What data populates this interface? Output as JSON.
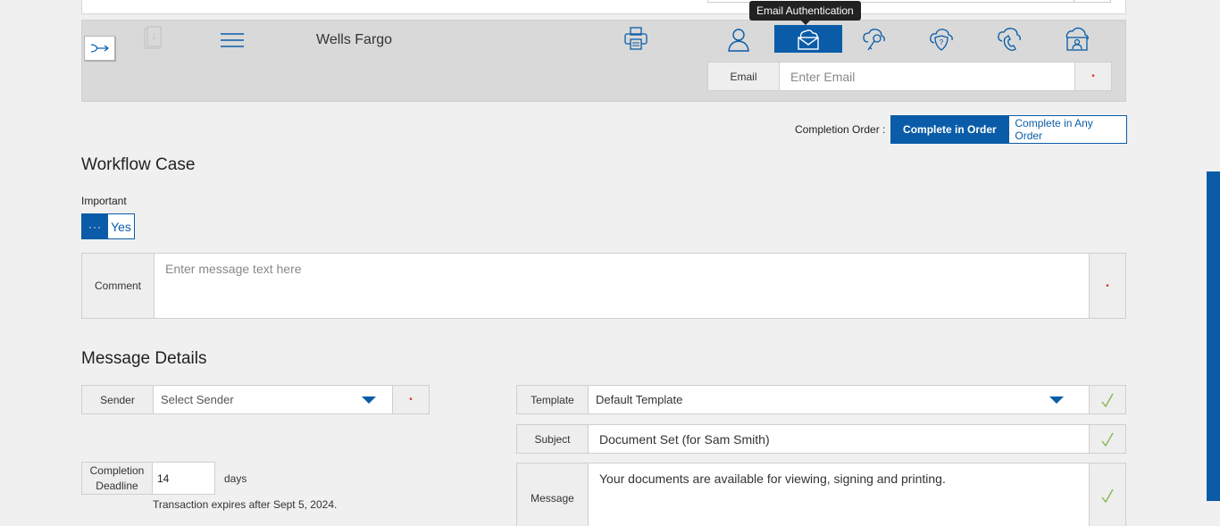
{
  "recipient": {
    "name": "Wells Fargo",
    "tooltip": "Email Authentication",
    "auth_icons": [
      "person-icon",
      "email-auth-icon",
      "key-icon",
      "security-question-icon",
      "phone-icon",
      "cloud-id-icon"
    ],
    "email_label": "Email",
    "email_placeholder": "Enter Email",
    "required_mark": "•"
  },
  "completion_order": {
    "label": "Completion Order :",
    "in_order": "Complete in Order",
    "any_order": "Complete in Any Order"
  },
  "workflow": {
    "title": "Workflow Case",
    "important_label": "Important",
    "toggle_knob": "···",
    "toggle_value": "Yes",
    "comment_label": "Comment",
    "comment_placeholder": "Enter message text here",
    "required_mark": "•"
  },
  "message_details": {
    "title": "Message Details",
    "sender_label": "Sender",
    "sender_placeholder": "Select Sender",
    "required_mark": "•",
    "template_label": "Template",
    "template_value": "Default Template",
    "subject_label": "Subject",
    "subject_value": "Document Set (for Sam Smith)",
    "message_label": "Message",
    "message_value": "Your documents are available for viewing, signing and printing.",
    "deadline_label_1": "Completion",
    "deadline_label_2": "Deadline",
    "deadline_value": "14",
    "deadline_unit": "days",
    "expiry_text": "Transaction expires after Sept 5, 2024."
  },
  "colors": {
    "accent": "#0a5ca8",
    "required": "#dd3333",
    "check": "#7ab648"
  }
}
